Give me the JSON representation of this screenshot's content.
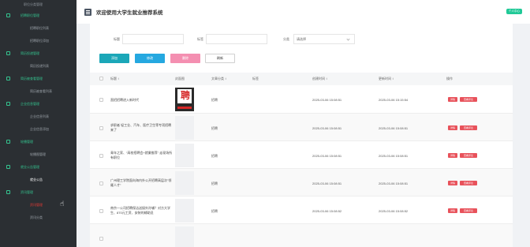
{
  "app": {
    "title": "欢迎使用大学生就业推荐系统",
    "user_badge": "个人中心"
  },
  "sidebar": {
    "top_item": "职位分类管理",
    "sections": [
      {
        "group": "招聘职位管理",
        "items": [
          "招聘职位列表",
          "招聘职位添加"
        ]
      },
      {
        "group": "简历投递管理",
        "items": [
          "简历投递列表"
        ]
      },
      {
        "group": "简历被查看管理",
        "items": [
          "简历被查看列表"
        ]
      },
      {
        "group": "企业信息管理",
        "items": [
          "企业信息列表",
          "企业信息添加"
        ]
      },
      {
        "group": "轮播管理",
        "items": [
          "轮播图管理"
        ]
      },
      {
        "group": "就业公告管理",
        "items": [
          "就业公告"
        ]
      },
      {
        "group": "资讯管理",
        "items": [
          "资讯管理",
          "资讯分类"
        ]
      }
    ]
  },
  "search": {
    "label1": "标题",
    "value1": "",
    "label2": "标签",
    "value2": "",
    "label3": "分类",
    "select_value": "请选择"
  },
  "toolbar": {
    "add": "添加",
    "edit": "修改",
    "delete": "删除",
    "refresh": "刷新"
  },
  "table": {
    "headers": [
      "标题 ↕",
      "封面图",
      "文章分类 ↕",
      "标签",
      "创建时间 ↕",
      "更新时间 ↕",
      "操作"
    ],
    "rows": [
      {
        "title": "直招招聘进入新时代",
        "category": "招聘",
        "tag": "",
        "created": "2025-03-06 15:08:51",
        "updated": "2025-03-06 15:15:54",
        "has_poster": true
      },
      {
        "title": "求职者 轻工业、汽车、医疗卫生等专项招聘来了",
        "category": "招聘",
        "tag": "",
        "created": "2025-03-06 15:08:51",
        "updated": "2025-03-06 15:08:51",
        "has_poster": false
      },
      {
        "title": "青年之家、“高校招聘会+就業推荐” 走现场所有职位",
        "category": "招聘",
        "tag": "",
        "created": "2025-03-06 15:08:51",
        "updated": "2025-03-06 15:08:51",
        "has_poster": false
      },
      {
        "title": "广州理工学院面向海内外公开招聘高层次“领雁人才”",
        "category": "招聘",
        "tag": "",
        "created": "2025-03-06 15:08:51",
        "updated": "2025-03-06 15:08:51",
        "has_poster": false
      },
      {
        "title": "南京一公司招聘保洁送接外孙辅？对方大学生、870元工资、安装的辅助员",
        "category": "招聘",
        "tag": "",
        "created": "2025-03-06 15:08:52",
        "updated": "2025-03-06 15:08:52",
        "has_poster": false
      },
      {
        "title": "",
        "category": "",
        "tag": "",
        "created": "",
        "updated": "",
        "has_poster": false
      }
    ],
    "row_actions": {
      "detail": "详情",
      "comment": "查看评论"
    }
  },
  "poster": {
    "glyph": "聘"
  }
}
